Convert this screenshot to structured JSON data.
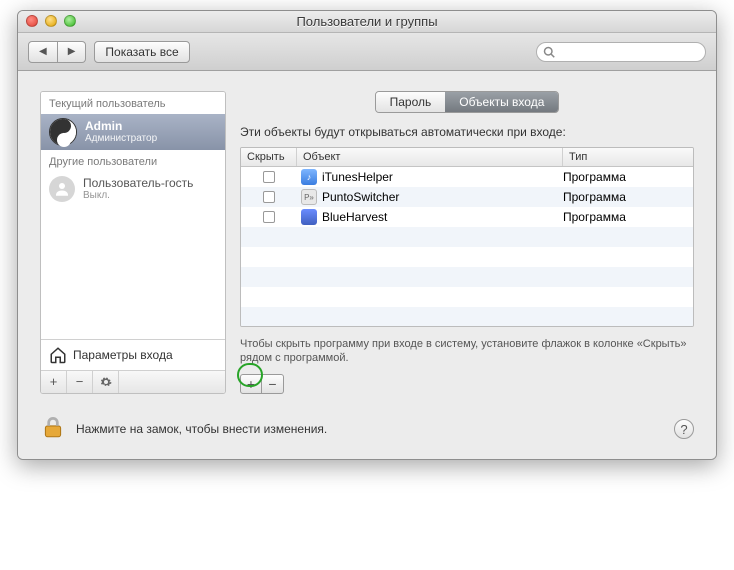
{
  "window": {
    "title": "Пользователи и группы"
  },
  "toolbar": {
    "show_all": "Показать все",
    "search_placeholder": ""
  },
  "sidebar": {
    "current_header": "Текущий пользователь",
    "other_header": "Другие пользователи",
    "admin": {
      "name": "Admin",
      "role": "Администратор"
    },
    "guest": {
      "name": "Пользователь-гость",
      "status": "Выкл."
    },
    "login_options": "Параметры входа"
  },
  "tabs": {
    "password": "Пароль",
    "login_items": "Объекты входа"
  },
  "main": {
    "caption": "Эти объекты будут открываться автоматически при входе:",
    "columns": {
      "hide": "Скрыть",
      "object": "Объект",
      "type": "Тип"
    },
    "rows": [
      {
        "name": "iTunesHelper",
        "type": "Программа",
        "icon": "itunes"
      },
      {
        "name": "PuntoSwitcher",
        "type": "Программа",
        "icon": "punto"
      },
      {
        "name": "BlueHarvest",
        "type": "Программа",
        "icon": "blue"
      }
    ],
    "note": "Чтобы скрыть программу при входе в систему, установите флажок в колонке «Скрыть» рядом с программой."
  },
  "footer": {
    "lock_text": "Нажмите на замок, чтобы внести изменения."
  }
}
